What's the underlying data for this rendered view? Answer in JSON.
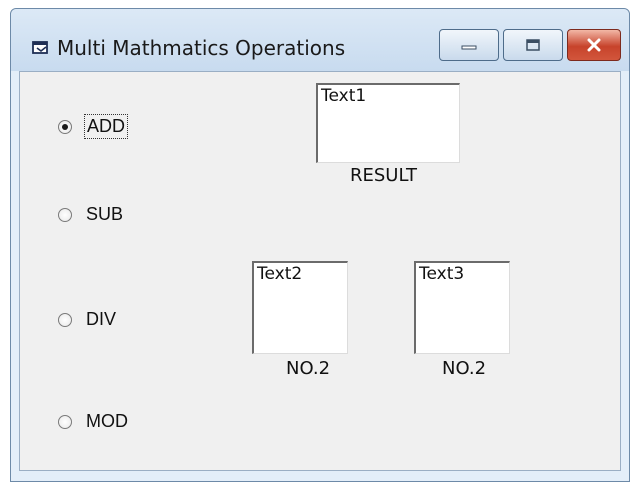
{
  "window": {
    "title": "Multi Mathmatics Operations",
    "controls": {
      "minimize": "minimize",
      "maximize": "maximize",
      "close": "close"
    }
  },
  "options": [
    {
      "label": "ADD",
      "selected": true
    },
    {
      "label": "SUB",
      "selected": false
    },
    {
      "label": "DIV",
      "selected": false
    },
    {
      "label": "MOD",
      "selected": false
    }
  ],
  "textboxes": {
    "result": {
      "value": "Text1",
      "caption": "RESULT"
    },
    "first": {
      "value": "Text2",
      "caption": "NO.2"
    },
    "second": {
      "value": "Text3",
      "caption": "NO.2"
    }
  },
  "colors": {
    "close_button": "#c7432b",
    "client_bg": "#f0f0f0"
  }
}
